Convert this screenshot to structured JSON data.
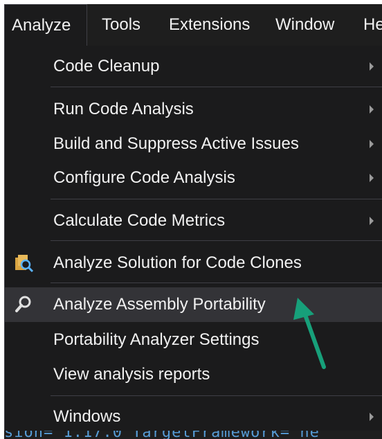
{
  "menubar": {
    "items": [
      {
        "label": "Analyze"
      },
      {
        "label": "Tools"
      },
      {
        "label": "Extensions"
      },
      {
        "label": "Window"
      },
      {
        "label": "He"
      }
    ]
  },
  "menu": {
    "items": [
      {
        "label": "Code Cleanup",
        "submenu": true
      },
      {
        "label": "Run Code Analysis",
        "submenu": true
      },
      {
        "label": "Build and Suppress Active Issues",
        "submenu": true
      },
      {
        "label": "Configure Code Analysis",
        "submenu": true
      },
      {
        "label": "Calculate Code Metrics",
        "submenu": true
      },
      {
        "label": "Analyze Solution for Code Clones",
        "icon": "code-clones-icon"
      },
      {
        "label": "Analyze Assembly Portability",
        "icon": "magnifier-icon",
        "highlighted": true
      },
      {
        "label": "Portability Analyzer Settings"
      },
      {
        "label": "View analysis reports"
      },
      {
        "label": "Windows",
        "submenu": true
      }
    ]
  },
  "code_strip": {
    "text": "sion= 1.17.0  TargetFramework= ne"
  },
  "colors": {
    "annotation_arrow": "#17a07a",
    "menu_bg": "#1b1b1c",
    "hover_bg": "#333337"
  }
}
